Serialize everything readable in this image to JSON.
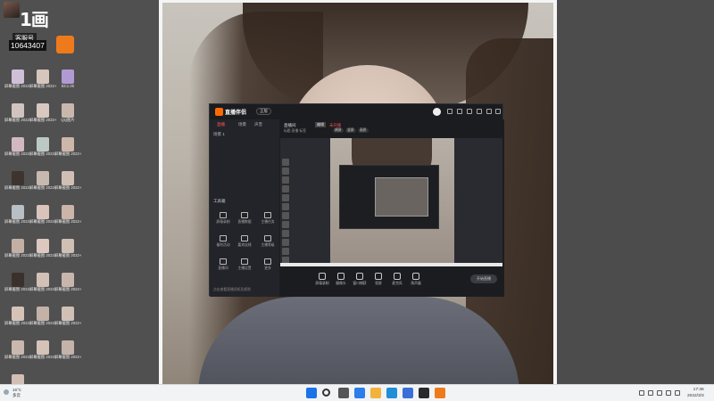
{
  "overlay": {
    "logo_text": "1画",
    "label": "客服号",
    "number": "10643407"
  },
  "desktop_icons": [
    {
      "label": "屏幕截图 2022-02...",
      "color": "#cfc0d8"
    },
    {
      "label": "屏幕截图 2022-02...",
      "color": "#d7c6bc"
    },
    {
      "label": "BC1.00",
      "color": "#b19ad4"
    },
    {
      "label": "屏幕截图 2022-02...",
      "color": "#d1c4c0"
    },
    {
      "label": "屏幕截图 2022-01...",
      "color": "#d8c8c0"
    },
    {
      "label": "QQ图片",
      "color": "#c9b7ae"
    },
    {
      "label": "屏幕截图 2022-02...",
      "color": "#d4b8c0"
    },
    {
      "label": "屏幕截图 2022-01...",
      "color": "#bcc8c4"
    },
    {
      "label": "屏幕截图 2022-02...",
      "color": "#cdb6aa"
    },
    {
      "label": "屏幕截图 2022-02...",
      "color": "#3e342f"
    },
    {
      "label": "屏幕截图 2022-01...",
      "color": "#c7b9b0"
    },
    {
      "label": "屏幕截图 2022-02...",
      "color": "#d1bfb5"
    },
    {
      "label": "屏幕截图 2022-01...",
      "color": "#b8c0c6"
    },
    {
      "label": "屏幕截图 2022-01...",
      "color": "#d9c4bb"
    },
    {
      "label": "屏幕截图 2022-02...",
      "color": "#cbb4a8"
    },
    {
      "label": "屏幕截图 2022-02...",
      "color": "#c3b0a4"
    },
    {
      "label": "屏幕截图 2022-01...",
      "color": "#dcc8c0"
    },
    {
      "label": "屏幕截图 2022-02...",
      "color": "#cfbfb4"
    },
    {
      "label": "屏幕截图 2022-02...",
      "color": "#3a302c"
    },
    {
      "label": "屏幕截图 2022-01...",
      "color": "#d3c0b6"
    },
    {
      "label": "屏幕截图 2022-02...",
      "color": "#c8b6ad"
    },
    {
      "label": "屏幕截图 2022-02...",
      "color": "#d6c3b8"
    },
    {
      "label": "屏幕截图 2022-01...",
      "color": "#c2b2a8"
    },
    {
      "label": "屏幕截图 2022-02...",
      "color": "#d0c0b6"
    },
    {
      "label": "屏幕截图 2022-02...",
      "color": "#cab8ae"
    },
    {
      "label": "屏幕截图 2022-01...",
      "color": "#d5c2b9"
    },
    {
      "label": "屏幕截图 2022-02...",
      "color": "#c4b3a9"
    },
    {
      "label": "屏幕截图 2022-02...",
      "color": "#d2bfb4"
    }
  ],
  "app": {
    "name": "直播伴侣",
    "badge": "正版",
    "tabs": [
      "直播",
      "场景",
      "声音"
    ],
    "scene_label": "场景 1",
    "tools_title": "工具箱",
    "tools": [
      {
        "label": "屏幕录制",
        "icon": "monitor-icon"
      },
      {
        "label": "直播数据",
        "icon": "chart-icon"
      },
      {
        "label": "主播任务",
        "icon": "task-icon"
      },
      {
        "label": "福利活动",
        "icon": "gift-icon"
      },
      {
        "label": "嘉宾连线",
        "icon": "link-icon"
      },
      {
        "label": "主播等级",
        "icon": "level-icon"
      },
      {
        "label": "直播间",
        "icon": "room-icon"
      },
      {
        "label": "主播设置",
        "icon": "settings-icon"
      },
      {
        "label": "更多",
        "icon": "more-icon"
      }
    ],
    "footer_text": "点击查看直播须知及规则",
    "room_title": "直播间",
    "room_tag": "编辑",
    "room_status": "未开播",
    "room_meta": "标题  直播  标签",
    "pills": [
      "横屏",
      "竖屏",
      "画质"
    ],
    "bottom_actions": [
      {
        "label": "屏幕录制",
        "icon": "record-icon"
      },
      {
        "label": "摄像头",
        "icon": "camera-icon"
      },
      {
        "label": "窗口捕获",
        "icon": "window-icon"
      },
      {
        "label": "投屏",
        "icon": "cast-icon"
      },
      {
        "label": "麦克风",
        "icon": "mic-icon"
      },
      {
        "label": "扬声器",
        "icon": "speaker-icon"
      }
    ],
    "start_button": "开始直播"
  },
  "taskbar": {
    "weather_temp": "16°C",
    "weather_desc": "多云",
    "time": "17:36",
    "date": "2022/3/3",
    "apps": [
      {
        "name": "windows-start-icon",
        "color": "#1a73e8"
      },
      {
        "name": "search-icon",
        "color": "#333333"
      },
      {
        "name": "task-view-icon",
        "color": "#555555"
      },
      {
        "name": "widgets-icon",
        "color": "#2b7de9"
      },
      {
        "name": "file-explorer-icon",
        "color": "#f2b33d"
      },
      {
        "name": "edge-icon",
        "color": "#1f8fd8"
      },
      {
        "name": "store-icon",
        "color": "#3a6fd8"
      },
      {
        "name": "terminal-icon",
        "color": "#2a2a2a"
      },
      {
        "name": "live-app-icon",
        "color": "#ee7a1c"
      }
    ]
  }
}
